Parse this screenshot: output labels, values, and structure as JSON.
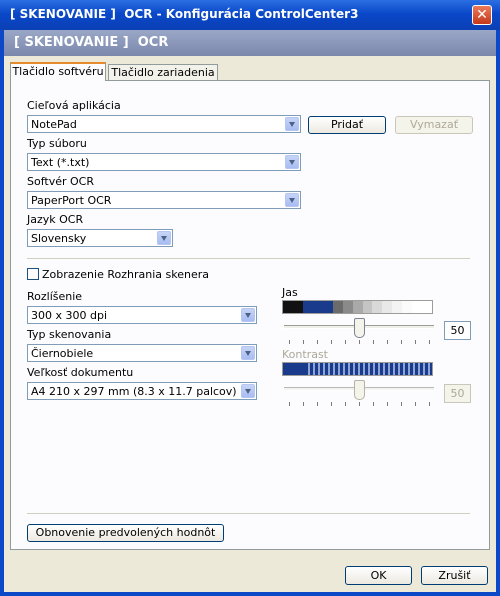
{
  "window": {
    "title": "[ SKENOVANIE ]  OCR - Konfigurácia ControlCenter3",
    "header": "[ SKENOVANIE ]  OCR"
  },
  "tabs": [
    {
      "label": "Tlačidlo softvéru",
      "active": true
    },
    {
      "label": "Tlačidlo zariadenia",
      "active": false
    }
  ],
  "target_app": {
    "label": "Cieľová aplikácia",
    "value": "NotePad",
    "add_label": "Pridať",
    "delete_label": "Vymazať"
  },
  "file_type": {
    "label": "Typ súboru",
    "value": "Text (*.txt)"
  },
  "ocr_software": {
    "label": "Softvér OCR",
    "value": "PaperPort OCR"
  },
  "ocr_language": {
    "label": "Jazyk OCR",
    "value": "Slovensky"
  },
  "show_scanner_interface": {
    "label": "Zobrazenie Rozhrania skenera",
    "checked": false
  },
  "resolution": {
    "label": "Rozlíšenie",
    "value": "300 x 300 dpi"
  },
  "scan_type": {
    "label": "Typ skenovania",
    "value": "Čiernobiele"
  },
  "document_size": {
    "label": "Veľkosť dokumentu",
    "value": "A4 210 x 297 mm (8.3 x 11.7 palcov)"
  },
  "brightness": {
    "label": "Jas",
    "value": "50",
    "level": 0.5,
    "enabled": true
  },
  "contrast": {
    "label": "Kontrast",
    "value": "50",
    "level": 0.5,
    "enabled": false
  },
  "restore_defaults_label": "Obnovenie predvolených hodnôt",
  "ok_label": "OK",
  "cancel_label": "Zrušiť",
  "colors": {
    "titlebar": "#0a48c9",
    "header_band": "#8592b5",
    "tab_highlight": "#e68b2c",
    "contrast_bar": "#1a3b8c"
  }
}
